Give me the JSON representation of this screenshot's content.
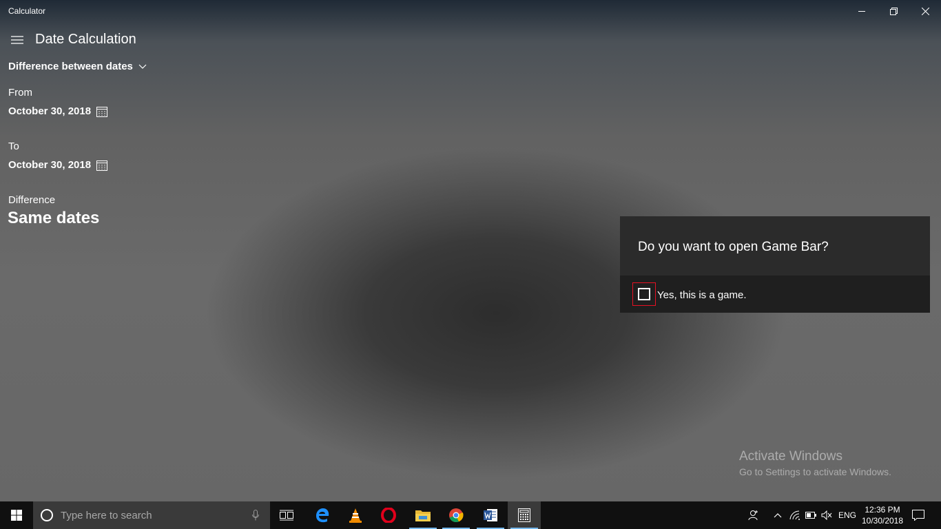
{
  "window": {
    "title": "Calculator"
  },
  "header": {
    "title": "Date Calculation"
  },
  "mode": {
    "selected": "Difference between dates"
  },
  "from": {
    "label": "From",
    "date": "October 30, 2018"
  },
  "to": {
    "label": "To",
    "date": "October 30, 2018"
  },
  "difference": {
    "label": "Difference",
    "value": "Same dates"
  },
  "gamebar": {
    "question": "Do you want to open Game Bar?",
    "checkbox_label": "Yes, this is a game."
  },
  "watermark": {
    "title": "Activate Windows",
    "subtitle": "Go to Settings to activate Windows."
  },
  "taskbar": {
    "search_placeholder": "Type here to search",
    "language": "ENG",
    "time": "12:36 PM",
    "date": "10/30/2018",
    "apps": [
      "task-view",
      "edge",
      "vlc",
      "opera",
      "file-explorer",
      "chrome",
      "word",
      "calculator"
    ]
  },
  "colors": {
    "accent": "#76b9ed",
    "focus_outline": "#e81123",
    "dialog_bg": "#2b2b2b"
  }
}
